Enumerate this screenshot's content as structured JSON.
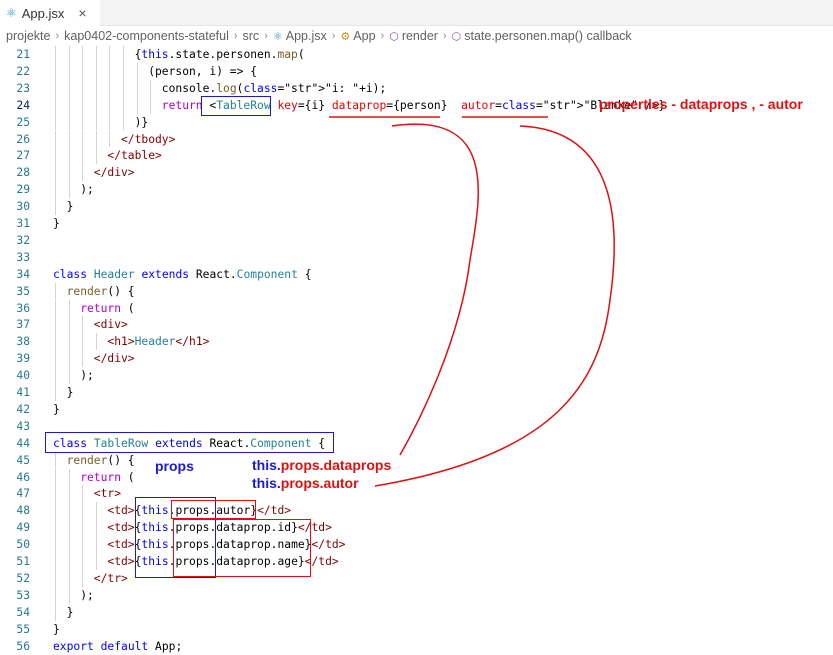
{
  "tab": {
    "label": "App.jsx",
    "close_glyph": "×",
    "icon": "react-icon"
  },
  "breadcrumb": [
    {
      "label": "projekte",
      "icon": ""
    },
    {
      "label": "kap0402-components-stateful",
      "icon": ""
    },
    {
      "label": "src",
      "icon": ""
    },
    {
      "label": "App.jsx",
      "icon": "react-icon"
    },
    {
      "label": "App",
      "icon": "class-icon"
    },
    {
      "label": "render",
      "icon": "method-icon"
    },
    {
      "label": "state.personen.map() callback",
      "icon": "method-icon"
    }
  ],
  "code": {
    "active_line": "24",
    "lines": [
      {
        "n": "21",
        "text": "{this.state.personen.map("
      },
      {
        "n": "22",
        "text": "(person, i) => {"
      },
      {
        "n": "23",
        "text": "console.log(\"i: \"+i);"
      },
      {
        "n": "24",
        "text": "return <TableRow key={i} dataprop={person}  autor=\"Blanke\" />}"
      },
      {
        "n": "25",
        "text": ")}"
      },
      {
        "n": "26",
        "text": "</tbody>"
      },
      {
        "n": "27",
        "text": "</table>"
      },
      {
        "n": "28",
        "text": "</div>"
      },
      {
        "n": "29",
        "text": ");"
      },
      {
        "n": "30",
        "text": "}"
      },
      {
        "n": "31",
        "text": "}"
      },
      {
        "n": "32",
        "text": ""
      },
      {
        "n": "33",
        "text": ""
      },
      {
        "n": "34",
        "text": "class Header extends React.Component {"
      },
      {
        "n": "35",
        "text": "render() {"
      },
      {
        "n": "36",
        "text": "return ("
      },
      {
        "n": "37",
        "text": "<div>"
      },
      {
        "n": "38",
        "text": "<h1>Header</h1>"
      },
      {
        "n": "39",
        "text": "</div>"
      },
      {
        "n": "40",
        "text": ");"
      },
      {
        "n": "41",
        "text": "}"
      },
      {
        "n": "42",
        "text": "}"
      },
      {
        "n": "43",
        "text": ""
      },
      {
        "n": "44",
        "text": "class TableRow extends React.Component {"
      },
      {
        "n": "45",
        "text": "render() {"
      },
      {
        "n": "46",
        "text": "return ("
      },
      {
        "n": "47",
        "text": "<tr>"
      },
      {
        "n": "48",
        "text": "<td>{this.props.autor}</td>"
      },
      {
        "n": "49",
        "text": "<td>{this.props.dataprop.id}</td>"
      },
      {
        "n": "50",
        "text": "<td>{this.props.dataprop.name}</td>"
      },
      {
        "n": "51",
        "text": "<td>{this.props.dataprop.age}</td>"
      },
      {
        "n": "52",
        "text": "</tr>"
      },
      {
        "n": "53",
        "text": ");"
      },
      {
        "n": "54",
        "text": "}"
      },
      {
        "n": "55",
        "text": "}"
      },
      {
        "n": "56",
        "text": "export default App;"
      }
    ]
  },
  "annotations": {
    "properties_note": "properties - dataprops , - autor",
    "props_label": "props",
    "this_prefix_1": "this.",
    "dataprops_label": "props.dataprops",
    "this_prefix_2": "this.",
    "autor_label": "props.autor"
  },
  "colors": {
    "annotation_red": "#e01010",
    "annotation_blue": "#1a1ad6",
    "line_number": "#237893",
    "keyword": "#0000ff",
    "tag": "#800000",
    "attribute": "#e50000"
  }
}
